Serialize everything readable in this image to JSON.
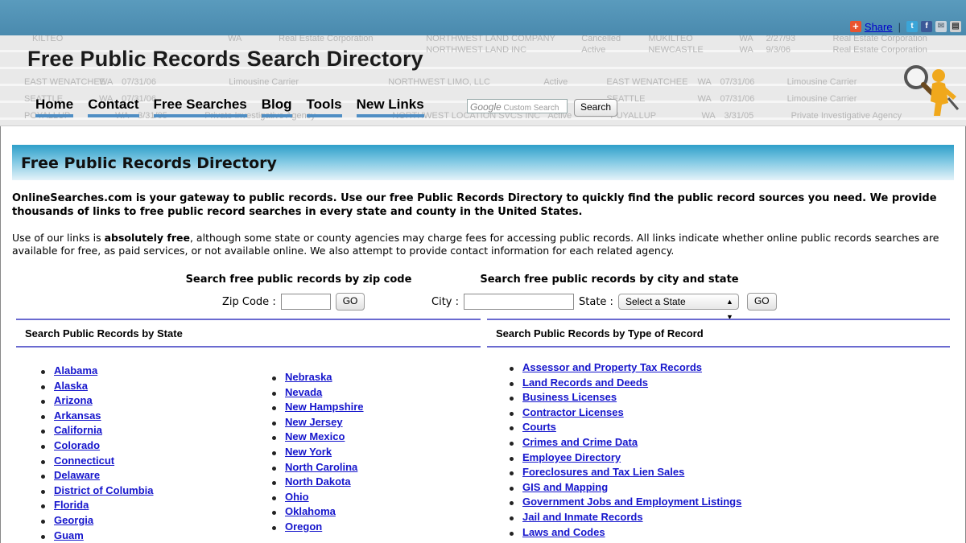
{
  "share": {
    "label": "Share",
    "separator": "|",
    "icons": [
      "plus-icon",
      "twitter-icon",
      "facebook-icon",
      "email-icon",
      "print-icon"
    ]
  },
  "header": {
    "site_title": "Free Public Records Search Directory",
    "nav": [
      "Home",
      "Contact",
      "Free Searches",
      "Blog",
      "Tools",
      "New Links"
    ],
    "search_brand": "Google",
    "search_placeholder": "Custom Search",
    "search_button": "Search",
    "background_rows": [
      [
        "KILTEO",
        "WA",
        "Real Estate Corporation",
        "NORTHWEST LAND COMPANY",
        "Cancelled",
        "MUKILTEO",
        "WA",
        "2/27/93",
        "Real Estate Corporation"
      ],
      [
        "",
        "",
        "",
        "NORTHWEST LAND INC",
        "Active",
        "NEWCASTLE",
        "WA",
        "9/3/06",
        "Real Estate Corporation"
      ],
      [
        "EAST WENATCHEE",
        "WA",
        "07/31/06",
        "Limousine Carrier",
        "NORTHWEST LIMO, LLC",
        "Active",
        "EAST WENATCHEE",
        "WA",
        "07/31/06",
        "Limousine Carrier"
      ],
      [
        "SEATTLE",
        "WA",
        "07/31/06",
        "",
        "",
        "",
        "SEATTLE",
        "WA",
        "07/31/06",
        "Limousine Carrier"
      ],
      [
        "POYALLUP",
        "WA",
        "3/31/05",
        "Private Investigative Agency",
        "NORTHWEST LOCATION SVCS INC",
        "Active",
        "PUYALLUP",
        "WA",
        "3/31/05",
        "Private Investigative Agency"
      ]
    ]
  },
  "main": {
    "section_title": "Free Public Records Directory",
    "intro_bold": "OnlineSearches.com is your gateway to public records. Use our free Public Records Directory to quickly find the public record sources you need. We provide thousands of links to free public record searches in every state and county in the United States.",
    "intro_part1": "Use of our links is ",
    "intro_strong": "absolutely free",
    "intro_part2": ", although some state or county agencies may charge fees for accessing public records. All links indicate whether online public records searches are available for free, as paid services, or not available online. We also attempt to provide contact information for each related agency."
  },
  "zip_search": {
    "heading": "Search free public records by zip code",
    "label": "Zip Code :",
    "value": "",
    "button": "GO"
  },
  "city_search": {
    "heading": "Search free public records by city and state",
    "city_label": "City :",
    "city_value": "",
    "state_label": "State :",
    "state_selected": "Select a State",
    "button": "GO"
  },
  "state_column": {
    "heading": "Search Public Records by State",
    "list_a": [
      "Alabama",
      "Alaska",
      "Arizona",
      "Arkansas",
      "California",
      "Colorado",
      "Connecticut",
      "Delaware",
      "District of Columbia",
      "Florida",
      "Georgia",
      "Guam"
    ],
    "list_b": [
      "Nebraska",
      "Nevada",
      "New Hampshire",
      "New Jersey",
      "New Mexico",
      "New York",
      "North Carolina",
      "North Dakota",
      "Ohio",
      "Oklahoma",
      "Oregon"
    ]
  },
  "type_column": {
    "heading": "Search Public Records by Type of Record",
    "items": [
      "Assessor and Property Tax Records",
      "Land Records and Deeds",
      "Business Licenses",
      "Contractor Licenses",
      "Courts",
      "Crimes and Crime Data",
      "Employee Directory",
      "Foreclosures and Tax Lien Sales",
      "GIS and Mapping",
      "Government Jobs and Employment Listings",
      "Jail and Inmate Records",
      "Laws and Codes"
    ]
  }
}
